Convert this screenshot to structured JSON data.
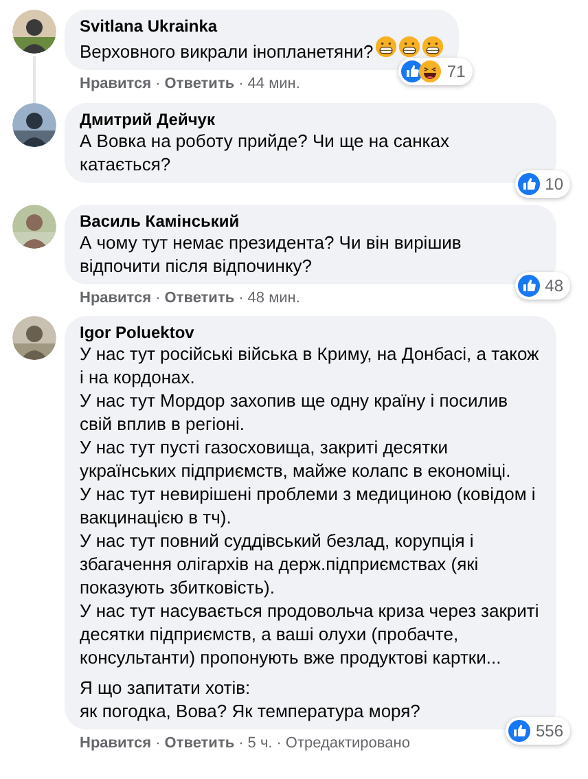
{
  "comments": [
    {
      "author": "Svitlana Ukrainka",
      "paragraphs": [
        "Верховного викрали інопланетяни?"
      ],
      "emoji_after": true,
      "reactions": [
        {
          "kind": "like"
        },
        {
          "kind": "haha"
        }
      ],
      "reaction_count": "71",
      "actions": [
        {
          "kind": "link",
          "text": "Нравится"
        },
        {
          "kind": "separator",
          "text": "·"
        },
        {
          "kind": "link",
          "text": "Ответить"
        },
        {
          "kind": "separator",
          "text": "·"
        },
        {
          "kind": "time",
          "text": "44 мин."
        }
      ],
      "thread_line": true
    },
    {
      "author": "Дмитрий Дейчук",
      "paragraphs": [
        "А Вовка на роботу прийде? Чи ще на санках катається?"
      ],
      "emoji_after": false,
      "reactions": [
        {
          "kind": "like"
        }
      ],
      "reaction_count": "10",
      "thread_line": false
    },
    {
      "author": "Василь Камінський",
      "paragraphs": [
        "А чому тут немає президента? Чи він вирішив відпочити після відпочинку?"
      ],
      "emoji_after": false,
      "reactions": [
        {
          "kind": "like"
        }
      ],
      "reaction_count": "48",
      "actions": [
        {
          "kind": "link",
          "text": "Нравится"
        },
        {
          "kind": "separator",
          "text": "·"
        },
        {
          "kind": "link",
          "text": "Ответить"
        },
        {
          "kind": "separator",
          "text": "·"
        },
        {
          "kind": "time",
          "text": "48 мин."
        }
      ],
      "thread_line": false
    },
    {
      "author": "Igor Poluektov",
      "paragraphs": [
        "У нас тут російські війська в Криму, на Донбасі, а також і на кордонах.\nУ нас тут Мордор захопив ще одну країну і посилив свій вплив в регіоні.\nУ нас тут пусті газосховища, закриті десятки українських підприємств, майже колапс в економіці.\nУ нас тут невирішені проблеми з медициною (ковідом і вакцинацією в тч).\nУ нас тут повний суддівський безлад, корупція і збагачення олігархів на держ.підприємствах (які показують збитковість).\nУ нас тут насувається продовольча криза через закриті десятки підприємств, а ваші олухи (пробачте, консультанти) пропонують вже продуктові картки...",
        "Я що запитати хотів:\nяк погодка, Вова? Як температура моря?"
      ],
      "emoji_after": false,
      "reactions": [
        {
          "kind": "like"
        }
      ],
      "reaction_count": "556",
      "actions": [
        {
          "kind": "link",
          "text": "Нравится"
        },
        {
          "kind": "separator",
          "text": "·"
        },
        {
          "kind": "link",
          "text": "Ответить"
        },
        {
          "kind": "separator",
          "text": "·"
        },
        {
          "kind": "time",
          "text": "5 ч."
        },
        {
          "kind": "separator",
          "text": "·"
        },
        {
          "kind": "label",
          "text": "Отредактировано"
        }
      ],
      "thread_line": false
    }
  ]
}
